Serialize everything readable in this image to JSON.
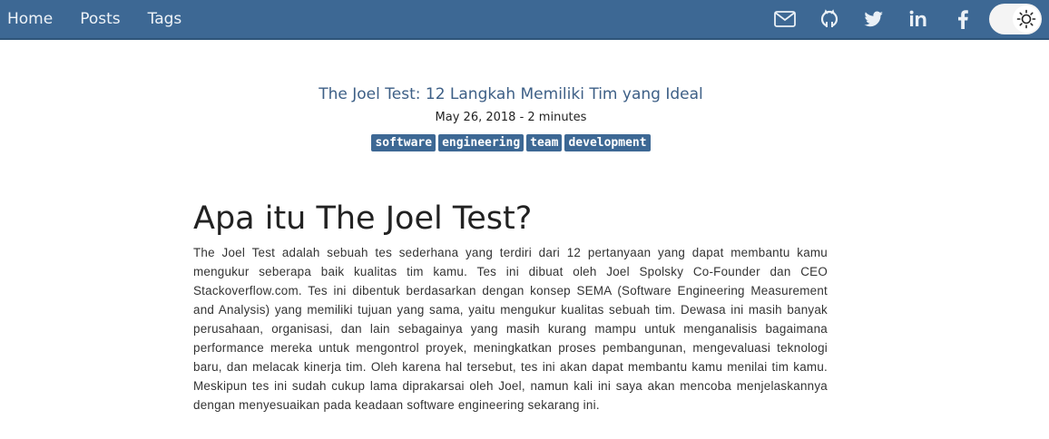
{
  "nav": {
    "links": [
      "Home",
      "Posts",
      "Tags"
    ],
    "icons": [
      "mail-icon",
      "github-icon",
      "twitter-icon",
      "linkedin-icon",
      "facebook-icon"
    ],
    "theme_toggle_icon": "sun-icon"
  },
  "post": {
    "title": "The Joel Test: 12 Langkah Memiliki Tim yang Ideal",
    "meta": "May 26, 2018 - 2 minutes",
    "tags": [
      "software",
      "engineering",
      "team",
      "development"
    ]
  },
  "article": {
    "heading": "Apa itu The Joel Test?",
    "paragraph": "The Joel Test adalah sebuah tes sederhana yang terdiri dari 12 pertanyaan yang dapat membantu kamu mengukur seberapa baik kualitas tim kamu. Tes ini dibuat oleh Joel Spolsky Co-Founder dan CEO Stackoverflow.com. Tes ini dibentuk berdasarkan dengan konsep SEMA (Software Engineering Measurement and Analysis) yang memiliki tujuan yang sama, yaitu mengukur kualitas sebuah tim. Dewasa ini masih banyak perusahaan, organisasi, dan lain sebagainya yang masih kurang mampu untuk menganalisis bagaimana performance mereka untuk mengontrol proyek, meningkatkan proses pembangunan, mengevaluasi teknologi baru, dan melacak kinerja tim. Oleh karena hal tersebut, tes ini akan dapat membantu kamu menilai tim kamu. Meskipun tes ini sudah cukup lama diprakarsai oleh Joel, namun kali ini saya akan mencoba menjelaskannya dengan menyesuaikan pada keadaan software engineering sekarang ini."
  },
  "colors": {
    "navbar": "#3d6894",
    "title": "#3d5f86",
    "tag_bg": "#3d6894"
  }
}
